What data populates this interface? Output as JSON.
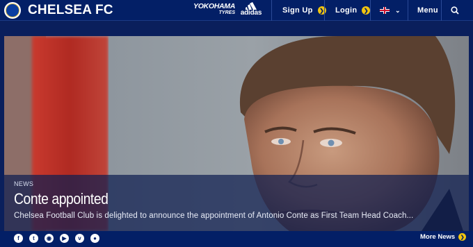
{
  "header": {
    "site_title": "CHELSEA FC",
    "sponsors": {
      "yokohama_line1": "YOKOHAMA",
      "yokohama_line2": "TYRES",
      "adidas": "adidas"
    },
    "nav": {
      "signup_label": "Sign Up",
      "login_label": "Login",
      "language_icon": "uk-flag-icon",
      "menu_label": "Menu",
      "search_icon": "search-icon"
    }
  },
  "hero": {
    "tag": "NEWS",
    "headline": "Conte appointed",
    "summary": "Chelsea Football Club is delighted to announce the appointment of Antonio Conte as First Team Head Coach..."
  },
  "footer": {
    "social_icons": [
      "facebook-icon",
      "twitter-icon",
      "instagram-icon",
      "youtube-icon",
      "vine-icon",
      "snapchat-icon"
    ],
    "more_news_label": "More News"
  },
  "colors": {
    "navy": "#031f66",
    "accent_yellow": "#f1c40f"
  }
}
